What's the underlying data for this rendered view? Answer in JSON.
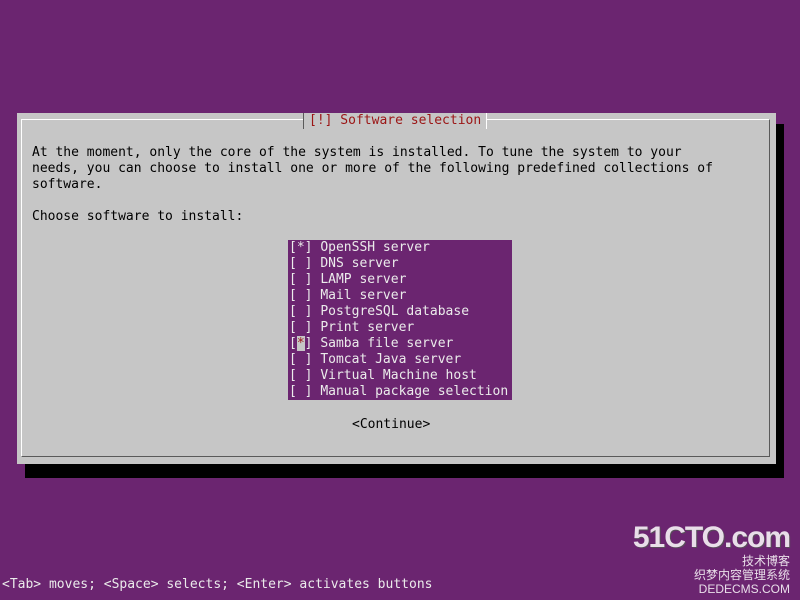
{
  "dialog": {
    "title": "[!] Software selection",
    "description_lines": [
      "At the moment, only the core of the system is installed. To tune the system to your",
      "needs, you can choose to install one or more of the following predefined collections of",
      "software."
    ],
    "prompt": "Choose software to install:",
    "software_options": [
      {
        "label": "OpenSSH server",
        "mark": "*",
        "selected": true
      },
      {
        "label": "DNS server",
        "mark": " ",
        "selected": false
      },
      {
        "label": "LAMP server",
        "mark": " ",
        "selected": false
      },
      {
        "label": "Mail server",
        "mark": " ",
        "selected": false
      },
      {
        "label": "PostgreSQL database",
        "mark": " ",
        "selected": false
      },
      {
        "label": "Print server",
        "mark": " ",
        "selected": false
      },
      {
        "label": "Samba file server",
        "mark": "*",
        "selected": true
      },
      {
        "label": "Tomcat Java server",
        "mark": " ",
        "selected": false
      },
      {
        "label": "Virtual Machine host",
        "mark": " ",
        "selected": false
      },
      {
        "label": "Manual package selection",
        "mark": " ",
        "selected": false
      }
    ],
    "continue_label": "<Continue>"
  },
  "help_bar": {
    "text": "<Tab> moves; <Space> selects; <Enter> activates buttons"
  },
  "watermark": {
    "brand": "51CTO.com",
    "line1": "技术博客",
    "line2": "织梦内容管理系统",
    "line3": "DEDECMS.COM"
  },
  "colors": {
    "background": "#6b2570",
    "dialog": "#c6c6c6",
    "title_text": "#9b1515",
    "list_background": "#6b2570",
    "list_text": "#ebebeb",
    "cursor_highlight": "#9b1515"
  }
}
